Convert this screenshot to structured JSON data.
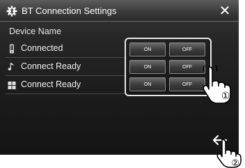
{
  "window": {
    "title": "BT Connection Settings",
    "close_label": "✕"
  },
  "section": {
    "label": "Device Name"
  },
  "devices": [
    {
      "icon": "phone-icon",
      "label": "Connected",
      "on_label": "ON",
      "off_label": "OFF"
    },
    {
      "icon": "music-note-icon",
      "label": "Connect Ready",
      "on_label": "ON",
      "off_label": "OFF"
    },
    {
      "icon": "grid-icon",
      "label": "Connect Ready",
      "on_label": "ON",
      "off_label": "OFF"
    }
  ],
  "callouts": {
    "first": "①",
    "second": "②"
  },
  "icons": {
    "title": "gear-bluetooth-icon",
    "back": "back-arrow-icon",
    "hand": "pointing-hand-icon"
  },
  "colors": {
    "accent": "#ffffff",
    "background": "#1c1c1c",
    "highlight_frame": "#e8e8e8"
  }
}
